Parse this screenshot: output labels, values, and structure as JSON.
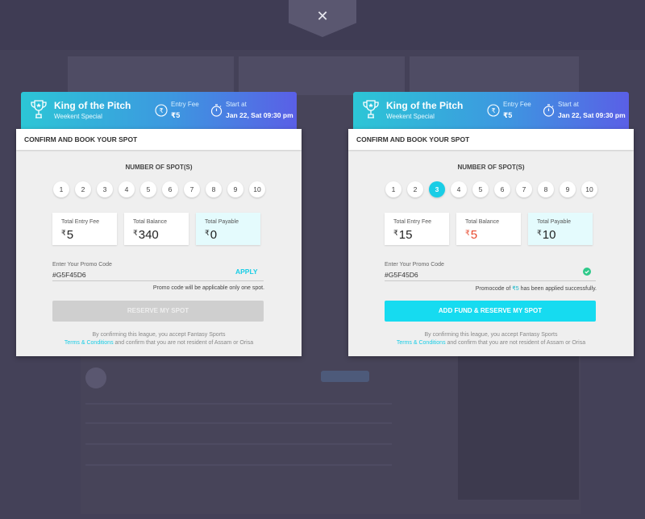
{
  "close": {
    "symbol": "✕"
  },
  "colors": {
    "accent": "#19cde6",
    "warn": "#e8472b",
    "header_start": "#2cc6d6",
    "header_end": "#5a5fe6"
  },
  "modals": [
    {
      "contest": {
        "title": "King of the Pitch",
        "subtitle": "Weekent Special",
        "entry_fee_label": "Entry Fee",
        "entry_fee_value": "₹5",
        "start_label": "Start at",
        "start_value": "Jan 22, Sat 09:30 pm"
      },
      "section_title": "CONFIRM AND BOOK YOUR SPOT",
      "spots_label": "NUMBER OF SPOT(S)",
      "spots": [
        "1",
        "2",
        "3",
        "4",
        "5",
        "6",
        "7",
        "8",
        "9",
        "10"
      ],
      "selected_spot": null,
      "stats": {
        "entry_label": "Total Entry Fee",
        "entry_value": "5",
        "balance_label": "Total Balance",
        "balance_value": "340",
        "payable_label": "Total Payable",
        "payable_value": "0",
        "currency": "₹"
      },
      "promo": {
        "label": "Enter Your Promo Code",
        "value": "#G5F45D6",
        "apply_label": "APPLY",
        "note": "Promo code will be applicable only one spot."
      },
      "reserve_label": "RESERVE MY SPOT",
      "footer_line1": "By confirming this league, you accept Fantasy Sports",
      "terms_label": "Terms & Conditions",
      "footer_line2": " and confirm that you are not resident of Assam or Orisa"
    },
    {
      "contest": {
        "title": "King of the Pitch",
        "subtitle": "Weekent Special",
        "entry_fee_label": "Entry Fee",
        "entry_fee_value": "₹5",
        "start_label": "Start at",
        "start_value": "Jan 22, Sat 09:30 pm"
      },
      "section_title": "CONFIRM AND BOOK YOUR SPOT",
      "spots_label": "NUMBER OF SPOT(S)",
      "spots": [
        "1",
        "2",
        "3",
        "4",
        "5",
        "6",
        "7",
        "8",
        "9",
        "10"
      ],
      "selected_spot": "3",
      "stats": {
        "entry_label": "Total Entry Fee",
        "entry_value": "15",
        "balance_label": "Total Balance",
        "balance_value": "5",
        "payable_label": "Total Payable",
        "payable_value": "10",
        "currency": "₹"
      },
      "promo": {
        "label": "Enter Your Promo Code",
        "value": "#G5F45D6",
        "note_prefix": "Promocode of ",
        "note_amount": "₹5",
        "note_suffix": " has been applied successfully."
      },
      "reserve_label": "ADD FUND & RESERVE MY SPOT",
      "footer_line1": "By confirming this league, you accept Fantasy Sports",
      "terms_label": "Terms & Conditions",
      "footer_line2": " and confirm that you are not resident of Assam or Orisa"
    }
  ]
}
